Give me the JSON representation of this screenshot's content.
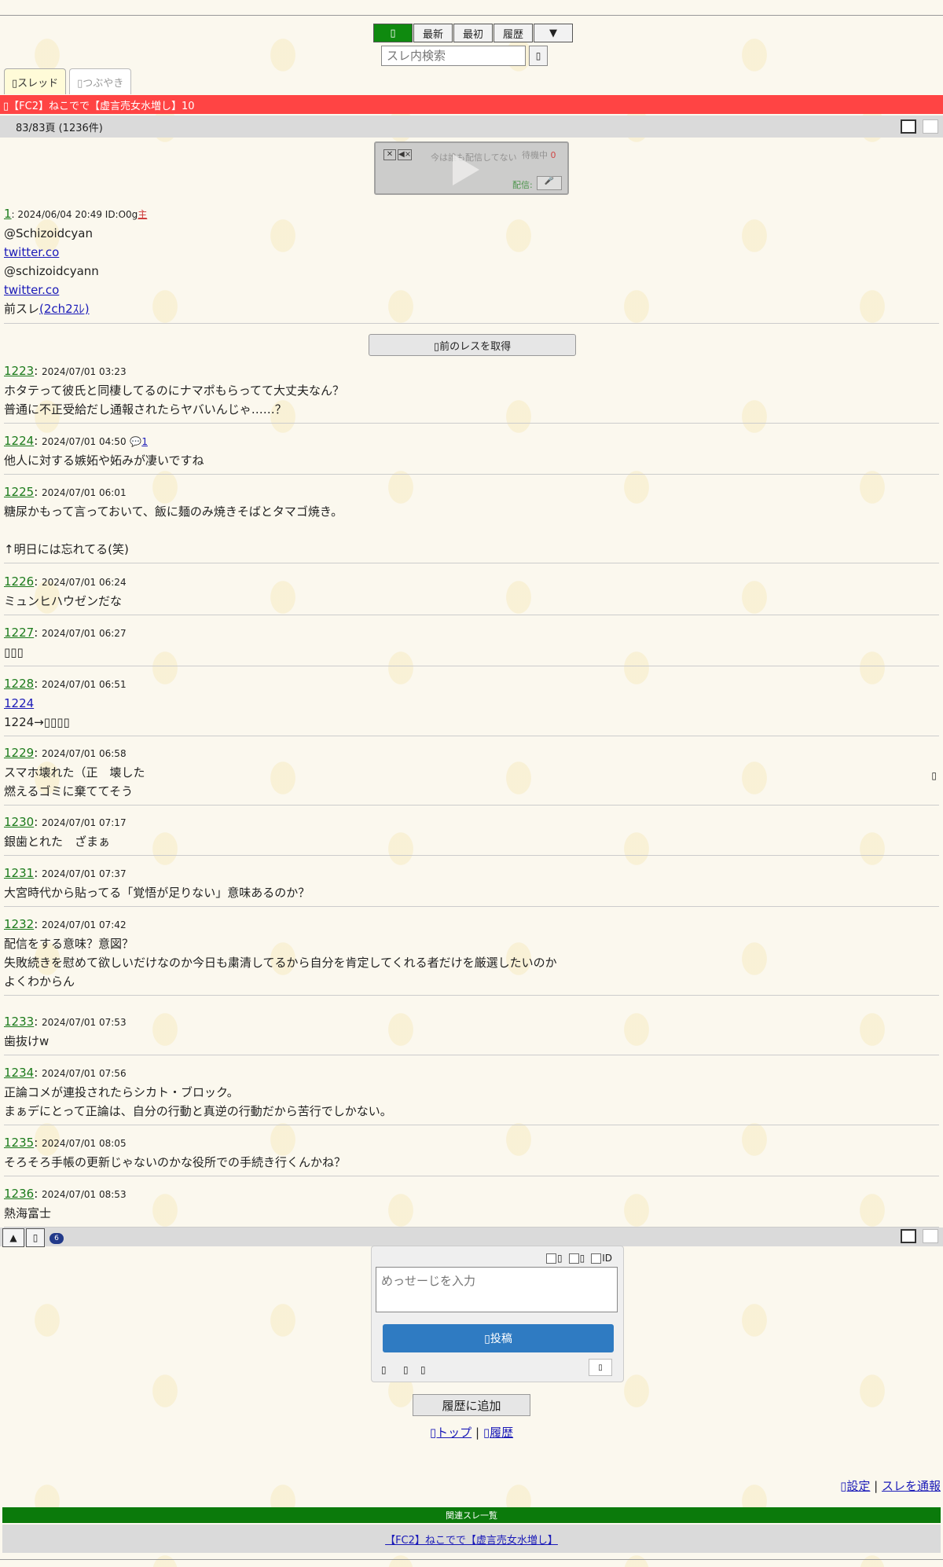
{
  "nav": {
    "home_glyph": "▯",
    "latest": "最新",
    "first": "最初",
    "history": "履歴",
    "menu": "▼"
  },
  "search": {
    "placeholder": "スレ内検索",
    "button_glyph": "▯"
  },
  "tabs": [
    {
      "label": "▯スレッド"
    },
    {
      "label": "▯つぶやき"
    }
  ],
  "thread": {
    "title": "▯【FC2】ねこでで【虚言売女水増し】10"
  },
  "page_info": "83/83頁 (1236件)",
  "player": {
    "close_glyph": "✕",
    "mute_glyph": "◀×",
    "status_text": "今は誰も配信してない",
    "waiting": "待機中",
    "waiting_count": "0",
    "broadcast_label": "配信:"
  },
  "op": {
    "num": "1",
    "meta": ": 2024/06/04 20:49 ID:O0g",
    "owner_mark": "主",
    "line1": "@Schizoidcyan",
    "link1": "twitter.co",
    "line2": "@schizoidcyann",
    "link2": "twitter.co",
    "prev_prefix": "前スレ",
    "prev_link": "(2ch2ｽﾚ)"
  },
  "prev_button": "▯前のレスを取得",
  "posts": [
    {
      "num": "1223",
      "date": "2024/07/01 03:23",
      "lines": [
        "ホタテって彼氏と同棲してるのにナマポもらってて大丈夫なん？",
        "普通に不正受給だし通報されたらヤバいんじゃ……？"
      ]
    },
    {
      "num": "1224",
      "date": "2024/07/01 04:50",
      "reply_icon": "💬",
      "reply_count": "1",
      "lines": [
        "他人に対する嫉妬や妬みが凄いですね"
      ]
    },
    {
      "num": "1225",
      "date": "2024/07/01 06:01",
      "lines": [
        "糖尿かもって言っておいて、飯に麺のみ焼きそばとタマゴ焼き。",
        "",
        "↑明日には忘れてる(笑)"
      ]
    },
    {
      "num": "1226",
      "date": "2024/07/01 06:24",
      "lines": [
        "ミュンヒハウゼンだな"
      ]
    },
    {
      "num": "1227",
      "date": "2024/07/01 06:27",
      "lines": [
        "▯▯▯"
      ]
    },
    {
      "num": "1228",
      "date": "2024/07/01 06:51",
      "anchor": "1224",
      "lines": [
        "1224→▯▯▯▯"
      ]
    },
    {
      "num": "1229",
      "date": "2024/07/01 06:58",
      "lines": [
        "スマホ壊れた（正　壊した",
        "燃えるゴミに棄ててそう"
      ]
    },
    {
      "num": "1230",
      "date": "2024/07/01 07:17",
      "lines": [
        "銀歯とれた　ざまぁ"
      ]
    },
    {
      "num": "1231",
      "date": "2024/07/01 07:37",
      "lines": [
        "大宮時代から貼ってる「覚悟が足りない」意味あるのか？"
      ]
    },
    {
      "num": "1232",
      "date": "2024/07/01 07:42",
      "lines": [
        "配信をする意味？意図？",
        "失敗続きを慰めて欲しいだけなのか今日も粛清してるから自分を肯定してくれる者だけを厳選したいのか",
        "よくわからん"
      ]
    },
    {
      "num": "1233",
      "date": "2024/07/01 07:53",
      "lines": [
        "歯抜けw"
      ]
    },
    {
      "num": "1234",
      "date": "2024/07/01 07:56",
      "lines": [
        "正論コメが連投されたらシカト・ブロック。",
        "まぁデにとって正論は、自分の行動と真逆の行動だから苦行でしかない。"
      ]
    },
    {
      "num": "1235",
      "date": "2024/07/01 08:05",
      "lines": [
        "そろそろ手帳の更新じゃないのかな役所での手続き行くんかね？"
      ]
    },
    {
      "num": "1236",
      "date": "2024/07/01 08:53",
      "lines": [
        "熱海富士"
      ]
    }
  ],
  "bottom": {
    "up_glyph": "▲",
    "glyph2": "▯",
    "badge": "6"
  },
  "form": {
    "opt1": "▯",
    "opt2": "▯",
    "opt3": "ID",
    "placeholder": "めっせーじを入力",
    "submit": "▯投稿",
    "icon1": "▯",
    "icon2": "▯",
    "icon3": "▯",
    "small": "▯"
  },
  "history_button": "履歴に追加",
  "links": {
    "top": "▯トップ",
    "sep": "|",
    "history": "▯履歴",
    "settings": "▯設定",
    "sep2": "|",
    "report": "スレを通報"
  },
  "related": {
    "header": "関連スレ一覧",
    "item": "【FC2】ねこでで【虚言売女水増し】"
  },
  "side_glyph": "▯"
}
